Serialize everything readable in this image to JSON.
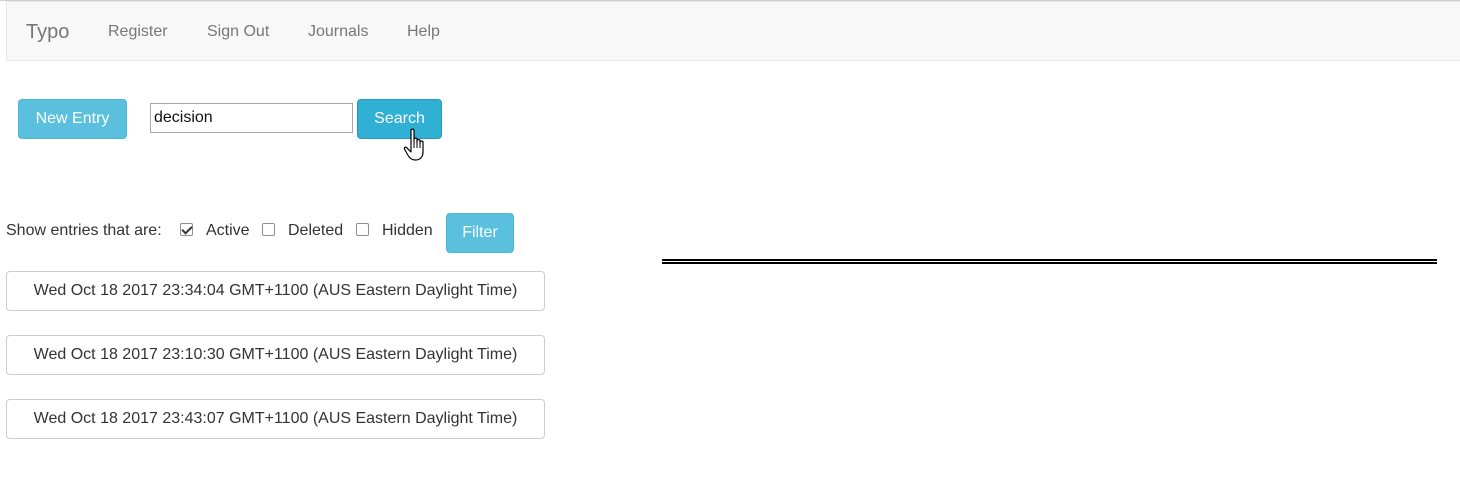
{
  "navbar": {
    "brand": "Typo",
    "links": [
      "Register",
      "Sign Out",
      "Journals",
      "Help"
    ]
  },
  "toolbar": {
    "new_entry_label": "New Entry",
    "search_value": "decision",
    "search_label": "Search"
  },
  "filters": {
    "label": "Show entries that are:",
    "options": [
      {
        "label": "Active",
        "checked": true
      },
      {
        "label": "Deleted",
        "checked": false
      },
      {
        "label": "Hidden",
        "checked": false
      }
    ],
    "filter_label": "Filter"
  },
  "entries": [
    "Wed Oct 18 2017 23:34:04 GMT+1100 (AUS Eastern Daylight Time)",
    "Wed Oct 18 2017 23:10:30 GMT+1100 (AUS Eastern Daylight Time)",
    "Wed Oct 18 2017 23:43:07 GMT+1100 (AUS Eastern Daylight Time)"
  ],
  "colors": {
    "info": "#5bc0de",
    "info_active": "#31b0d5",
    "navbar_bg": "#f8f8f8",
    "nav_text": "#777777"
  }
}
